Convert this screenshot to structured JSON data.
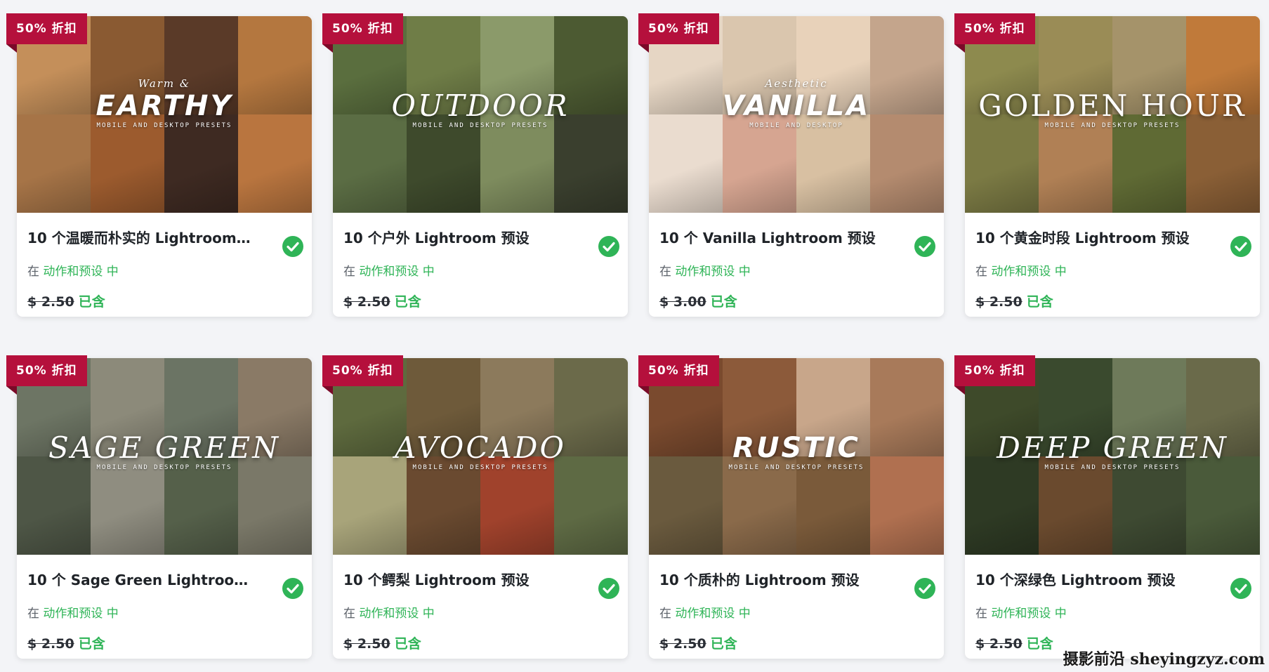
{
  "cards": [
    {
      "badge": "50% 折扣",
      "overlay_script": "Warm &",
      "overlay_title": "EARTHY",
      "overlay_style": "bold",
      "overlay_sub": "MOBILE AND DESKTOP PRESETS",
      "tiles": [
        "#c48f5a",
        "#8a5a32",
        "#5a3a28",
        "#b4773f",
        "#a67447",
        "#9c5b2e",
        "#3e2a22",
        "#b9753f"
      ],
      "title": "10 个温暖而朴实的 Lightroom ...",
      "category_prefix": "在 ",
      "category_link": "动作和预设 中",
      "price_old": "$ 2.50",
      "price_included": "已含"
    },
    {
      "badge": "50% 折扣",
      "overlay_script": "",
      "overlay_title": "OUTDOOR",
      "overlay_style": "italic",
      "overlay_sub": "MOBILE AND DESKTOP PRESETS",
      "tiles": [
        "#5a6e3e",
        "#6f7d47",
        "#8b9a6a",
        "#4c5a32",
        "#5b6d44",
        "#3e4a2c",
        "#7e8c5e",
        "#3a3f2e"
      ],
      "title": "10 个户外 Lightroom 预设",
      "category_prefix": "在 ",
      "category_link": "动作和预设 中",
      "price_old": "$ 2.50",
      "price_included": "已含"
    },
    {
      "badge": "50% 折扣",
      "overlay_script": "Aesthetic",
      "overlay_title": "VANILLA",
      "overlay_style": "bold",
      "overlay_sub": "MOBILE AND DESKTOP",
      "tiles": [
        "#e6d6c4",
        "#dac6ae",
        "#e8d2ba",
        "#c4a58c",
        "#eadccf",
        "#d6a591",
        "#d8c0a2",
        "#b48b6f"
      ],
      "title": "10 个 Vanilla Lightroom 预设",
      "category_prefix": "在 ",
      "category_link": "动作和预设 中",
      "price_old": "$ 3.00",
      "price_included": "已含"
    },
    {
      "badge": "50% 折扣",
      "overlay_script": "",
      "overlay_title": "GOLDEN HOUR",
      "overlay_style": "",
      "overlay_sub": "MOBILE AND DESKTOP PRESETS",
      "tiles": [
        "#8d8a4e",
        "#9a8c56",
        "#a5936a",
        "#c07a3a",
        "#7b7a44",
        "#b08055",
        "#5f6a34",
        "#8a5f36"
      ],
      "title": "10 个黄金时段 Lightroom 预设",
      "category_prefix": "在 ",
      "category_link": "动作和预设 中",
      "price_old": "$ 2.50",
      "price_included": "已含"
    },
    {
      "badge": "50% 折扣",
      "overlay_script": "",
      "overlay_title": "SAGE GREEN",
      "overlay_style": "italic",
      "overlay_sub": "MOBILE AND DESKTOP PRESETS",
      "tiles": [
        "#6d7564",
        "#8c8a7a",
        "#6b7464",
        "#8a7a66",
        "#4e5646",
        "#8f8d80",
        "#55604a",
        "#7a7868"
      ],
      "title": "10 个 Sage Green Lightroom ...",
      "category_prefix": "在 ",
      "category_link": "动作和预设 中",
      "price_old": "$ 2.50",
      "price_included": "已含"
    },
    {
      "badge": "50% 折扣",
      "overlay_script": "",
      "overlay_title": "AVOCADO",
      "overlay_style": "italic",
      "overlay_sub": "MOBILE AND DESKTOP PRESETS",
      "tiles": [
        "#5e6a3e",
        "#6e5a3a",
        "#8c7a5c",
        "#6b6a4a",
        "#a8a47a",
        "#6a4a30",
        "#a0422c",
        "#5e6a44"
      ],
      "title": "10 个鳄梨 Lightroom 预设",
      "category_prefix": "在 ",
      "category_link": "动作和预设 中",
      "price_old": "$ 2.50",
      "price_included": "已含"
    },
    {
      "badge": "50% 折扣",
      "overlay_script": "",
      "overlay_title": "RUSTIC",
      "overlay_style": "bold",
      "overlay_sub": "MOBILE AND DESKTOP PRESETS",
      "tiles": [
        "#7a4a2e",
        "#8c5a3a",
        "#c8a68a",
        "#a87a5a",
        "#6a5a3e",
        "#8a6a4a",
        "#7a5a3a",
        "#b07050"
      ],
      "title": "10 个质朴的 Lightroom 预设",
      "category_prefix": "在 ",
      "category_link": "动作和预设 中",
      "price_old": "$ 2.50",
      "price_included": "已含"
    },
    {
      "badge": "50% 折扣",
      "overlay_script": "",
      "overlay_title": "DEEP GREEN",
      "overlay_style": "italic",
      "overlay_sub": "MOBILE AND DESKTOP PRESETS",
      "tiles": [
        "#3e4a2a",
        "#3a4a2e",
        "#6e7a5a",
        "#6a6a4a",
        "#2e3a24",
        "#6a4a2e",
        "#3e4a32",
        "#4a5a3a"
      ],
      "title": "10 个深绿色 Lightroom 预设",
      "category_prefix": "在 ",
      "category_link": "动作和预设 中",
      "price_old": "$ 2.50",
      "price_included": "已含"
    }
  ],
  "watermark": "摄影前沿 sheyingzyz.com",
  "colors": {
    "badge": "#b5103c",
    "accent_green": "#2fb457",
    "background": "#f3f4f7"
  },
  "icons": {
    "check": "check-circle-icon"
  }
}
